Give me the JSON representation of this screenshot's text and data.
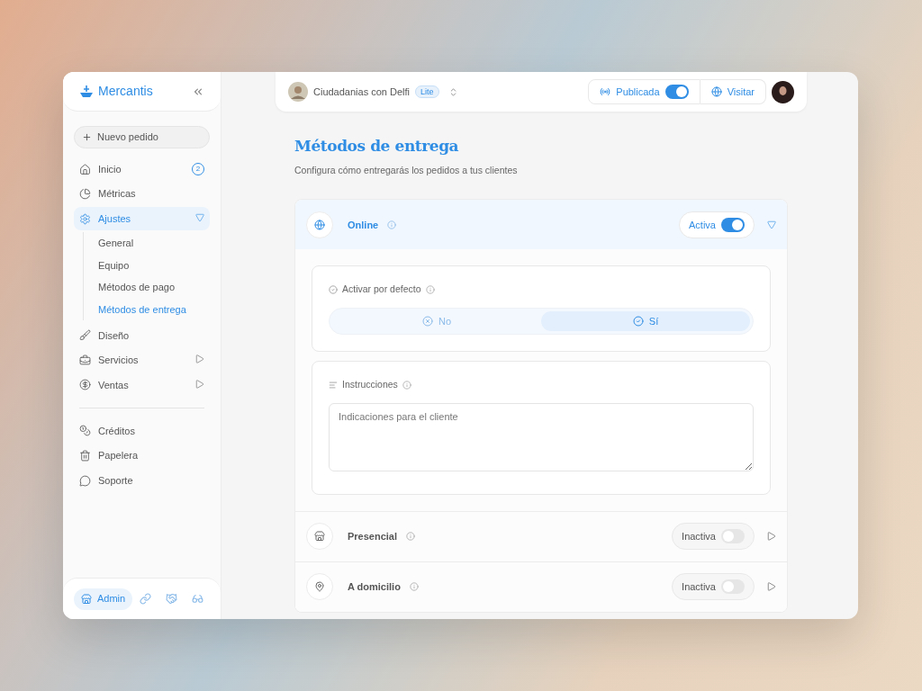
{
  "brand": {
    "name": "Mercantis"
  },
  "sidebar": {
    "new_order": "Nuevo pedido",
    "items": [
      {
        "label": "Inicio",
        "selected": false,
        "badge": "2"
      },
      {
        "label": "Métricas",
        "selected": false
      },
      {
        "label": "Ajustes",
        "selected": true,
        "expanded": true,
        "children": [
          {
            "label": "General",
            "selected": false
          },
          {
            "label": "Equipo",
            "selected": false
          },
          {
            "label": "Métodos de pago",
            "selected": false
          },
          {
            "label": "Métodos de entrega",
            "selected": true
          }
        ]
      },
      {
        "label": "Diseño",
        "selected": false
      },
      {
        "label": "Servicios",
        "selected": false,
        "expanded": false
      },
      {
        "label": "Ventas",
        "selected": false,
        "expanded": false
      }
    ],
    "secondary_items": [
      {
        "label": "Créditos",
        "selected": false
      },
      {
        "label": "Papelera",
        "selected": false
      },
      {
        "label": "Soporte",
        "selected": false
      }
    ],
    "footer": {
      "label": "Admin",
      "selected": true
    }
  },
  "topbar": {
    "store": "Ciudadanias con Delfi",
    "plan": "Lite",
    "publish": {
      "label": "Publicada",
      "on": true
    },
    "visit": "Visitar"
  },
  "page": {
    "title": "Métodos de entrega",
    "subtitle": "Configura cómo entregarás los pedidos a tus clientes"
  },
  "methods": [
    {
      "name": "Online",
      "status": "Activa",
      "on": true,
      "expanded": true,
      "default_setting": {
        "label": "Activar por defecto",
        "options": [
          {
            "label": "No",
            "selected": false
          },
          {
            "label": "Sí",
            "selected": true
          }
        ]
      },
      "instructions": {
        "label": "Instrucciones",
        "placeholder": "Indicaciones para el cliente"
      }
    },
    {
      "name": "Presencial",
      "status": "Inactiva",
      "on": false,
      "expanded": false
    },
    {
      "name": "A domicilio",
      "status": "Inactiva",
      "on": false,
      "expanded": false
    }
  ]
}
